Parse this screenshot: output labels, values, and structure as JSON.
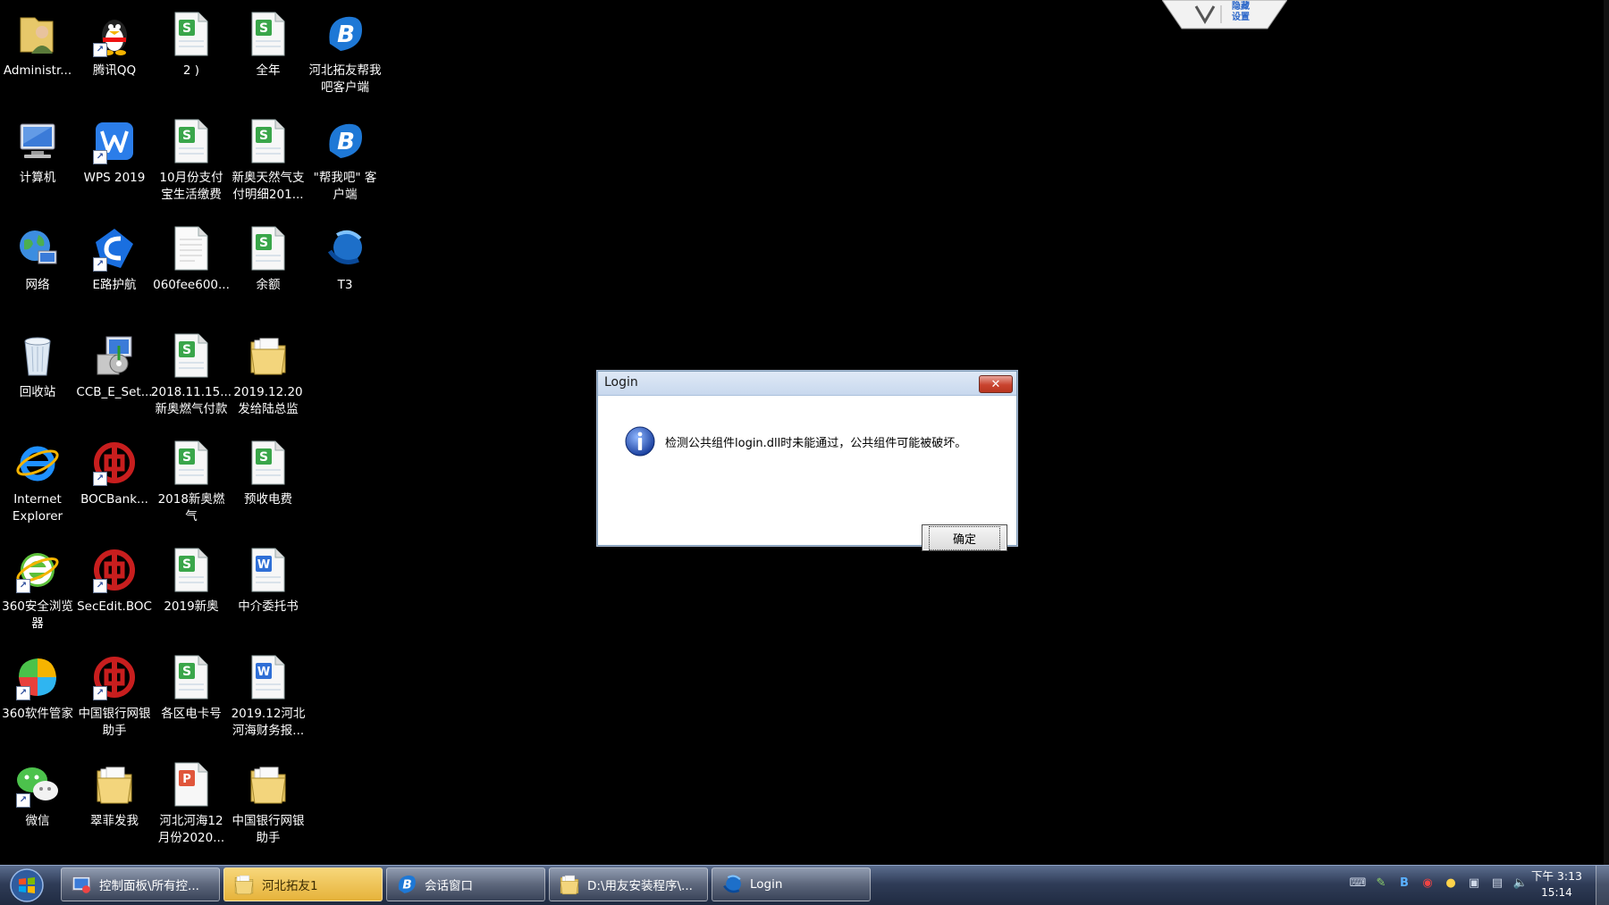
{
  "desktop": {
    "icons": [
      {
        "label": "Administr...",
        "icon": "user-folder-icon"
      },
      {
        "label": "腾讯QQ",
        "icon": "qq-penguin-icon"
      },
      {
        "label": "2 )",
        "icon": "spreadsheet-icon"
      },
      {
        "label": "全年",
        "icon": "spreadsheet-icon"
      },
      {
        "label": "河北拓友帮我\n吧客户端",
        "icon": "bangwoba-icon"
      },
      {
        "label": "计算机",
        "icon": "computer-icon"
      },
      {
        "label": "WPS 2019",
        "icon": "wps-icon"
      },
      {
        "label": "10月份支付\n宝生活缴费",
        "icon": "spreadsheet-icon"
      },
      {
        "label": "新奥天然气支\n付明细201...",
        "icon": "spreadsheet-icon"
      },
      {
        "label": "\"帮我吧\" 客\n户端",
        "icon": "bangwoba-icon"
      },
      {
        "label": "网络",
        "icon": "network-icon"
      },
      {
        "label": "E路护航",
        "icon": "elu-huhang-icon"
      },
      {
        "label": "060fee600...",
        "icon": "document-icon"
      },
      {
        "label": "余额",
        "icon": "spreadsheet-icon"
      },
      {
        "label": "T3",
        "icon": "t3-icon"
      },
      {
        "label": "回收站",
        "icon": "recycle-bin-icon"
      },
      {
        "label": "CCB_E_Set...",
        "icon": "installer-icon"
      },
      {
        "label": "2018.11.15...\n新奥燃气付款",
        "icon": "spreadsheet-icon"
      },
      {
        "label": "2019.12.20\n发给陆总监",
        "icon": "folder-icon"
      },
      {
        "label": "Internet\nExplorer",
        "icon": "internet-explorer-icon"
      },
      {
        "label": "BOCBank...",
        "icon": "boc-icon"
      },
      {
        "label": "2018新奥燃\n气",
        "icon": "spreadsheet-icon"
      },
      {
        "label": "预收电费",
        "icon": "spreadsheet-icon"
      },
      {
        "label": "360安全浏览\n器",
        "icon": "360-browser-icon"
      },
      {
        "label": "SecEdit.BOC",
        "icon": "boc-icon"
      },
      {
        "label": "2019新奥",
        "icon": "spreadsheet-icon"
      },
      {
        "label": "中介委托书",
        "icon": "word-doc-icon"
      },
      {
        "label": "360软件管家",
        "icon": "360-software-icon"
      },
      {
        "label": "中国银行网银\n助手",
        "icon": "boc-icon"
      },
      {
        "label": "各区电卡号",
        "icon": "spreadsheet-icon"
      },
      {
        "label": "2019.12河北\n河海财务报...",
        "icon": "word-doc-icon"
      },
      {
        "label": "微信",
        "icon": "wechat-icon"
      },
      {
        "label": "翠菲发我",
        "icon": "folder-icon"
      },
      {
        "label": "河北河海12\n月份2020...",
        "icon": "presentation-icon"
      },
      {
        "label": "中国银行网银\n助手",
        "icon": "folder-icon"
      }
    ]
  },
  "remote_tab": {
    "label": "隐藏\n设置"
  },
  "dialog": {
    "title": "Login",
    "close_label": "✕",
    "message": "检测公共组件login.dll时未能通过，公共组件可能被破坏。",
    "ok_label": "确定"
  },
  "taskbar": {
    "tasks": [
      {
        "label": "控制面板\\所有控...",
        "icon": "control-panel-icon",
        "active": false
      },
      {
        "label": "河北拓友1",
        "icon": "folder-icon",
        "active": true
      },
      {
        "label": "会话窗口",
        "icon": "bangwoba-icon",
        "active": false
      },
      {
        "label": "D:\\用友安装程序\\...",
        "icon": "folder-icon",
        "active": false
      },
      {
        "label": "Login",
        "icon": "t3-icon",
        "active": false
      }
    ],
    "clock_time": "下午 3:13",
    "clock_bottom": "15:14"
  },
  "colors": {
    "desktop_bg": "#000000",
    "spreadsheet_green": "#3aa64a",
    "word_blue": "#2f6fd6",
    "boc_red": "#c81e1e",
    "taskbar_active": "#e6b33a"
  }
}
